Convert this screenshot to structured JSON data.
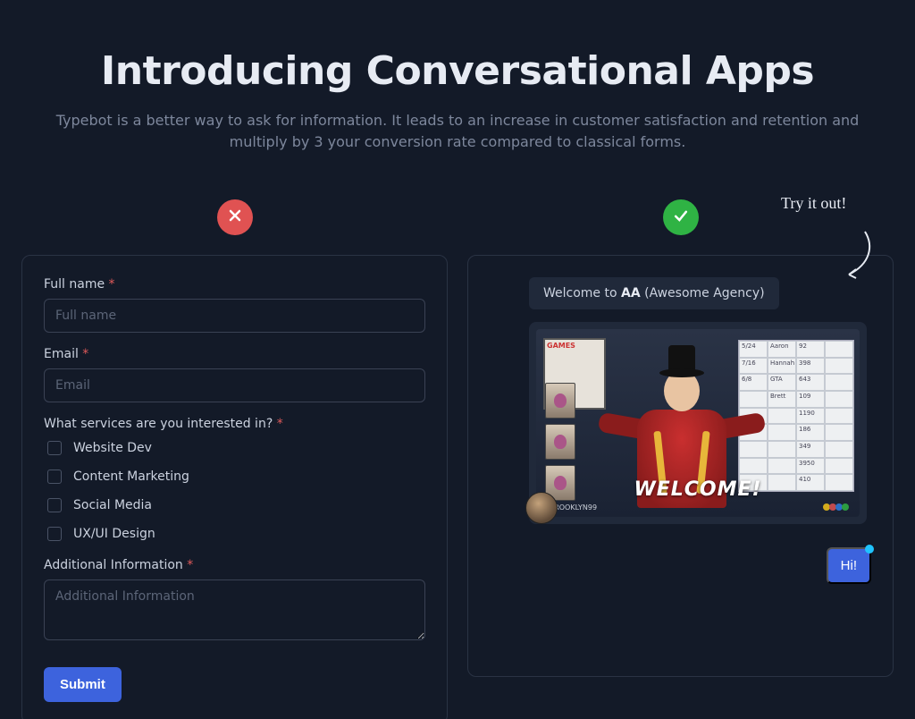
{
  "heading": "Introducing Conversational Apps",
  "sub": "Typebot is a better way to ask for information. It leads to an increase in customer satisfaction and retention and multiply by 3 your conversion rate compared to classical forms.",
  "badge_red_icon": "x-icon",
  "badge_green_icon": "check-icon",
  "form": {
    "fullname_label": "Full name",
    "fullname_placeholder": "Full name",
    "email_label": "Email",
    "email_placeholder": "Email",
    "services_label": "What services are you interested in?",
    "options": [
      "Website Dev",
      "Content Marketing",
      "Social Media",
      "UX/UI Design"
    ],
    "additional_label": "Additional Information",
    "additional_placeholder": "Additional Information",
    "submit": "Submit",
    "required_mark": "*"
  },
  "try_note": "Try it out!",
  "chat": {
    "bubble1_prefix": "Welcome to ",
    "bubble1_bold": "AA",
    "bubble1_suffix": " (Awesome Agency)",
    "gif_poster": "GAMES",
    "gif_welcome": "WELCOME!",
    "gif_tag": "#BROOKLYN99",
    "gif_logo": "NBC",
    "reply": "Hi!"
  }
}
